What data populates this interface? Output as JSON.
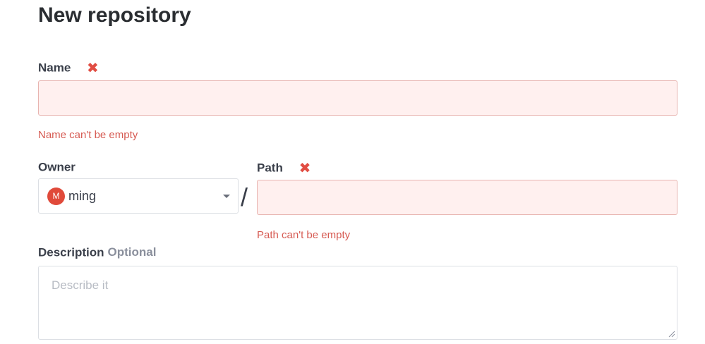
{
  "page": {
    "title": "New repository"
  },
  "form": {
    "name": {
      "label": "Name",
      "required_icon": "x-mark-icon",
      "value": "",
      "error": "Name can't be empty"
    },
    "owner": {
      "label": "Owner",
      "avatar_initial": "M",
      "value": "ming"
    },
    "separator": "/",
    "path": {
      "label": "Path",
      "required_icon": "x-mark-icon",
      "value": "",
      "error": "Path can't be empty"
    },
    "description": {
      "label": "Description",
      "optional_label": "Optional",
      "placeholder": "Describe it",
      "value": ""
    }
  },
  "colors": {
    "error": "#e14d43",
    "error_bg": "#fff0ef",
    "avatar": "#e04a3a"
  }
}
